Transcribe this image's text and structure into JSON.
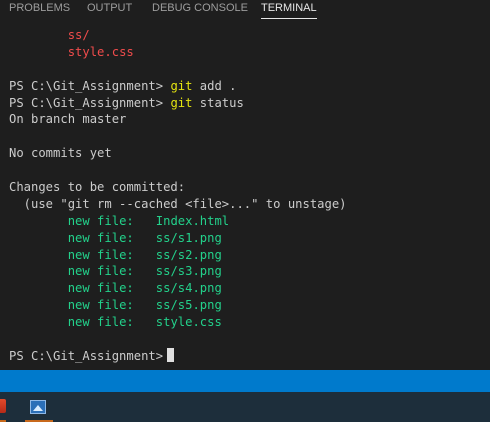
{
  "panel": {
    "tabs": [
      {
        "label": "PROBLEMS"
      },
      {
        "label": "OUTPUT"
      },
      {
        "label": "DEBUG CONSOLE"
      },
      {
        "label": "TERMINAL"
      }
    ],
    "active_tab": "TERMINAL"
  },
  "terminal": {
    "lines": {
      "l0": "ss/",
      "l1": "style.css",
      "prompt1": "PS C:\\Git_Assignment> ",
      "cmd1a": "git",
      "cmd1b": " add .",
      "prompt2": "PS C:\\Git_Assignment> ",
      "cmd2a": "git",
      "cmd2b": " status",
      "branch": "On branch master",
      "no_commits": "No commits yet",
      "changes": "Changes to be committed:",
      "hint": "  (use \"git rm --cached <file>...\" to unstage)",
      "staged": [
        {
          "status": "new file:",
          "file": "Index.html"
        },
        {
          "status": "new file:",
          "file": "ss/s1.png"
        },
        {
          "status": "new file:",
          "file": "ss/s2.png"
        },
        {
          "status": "new file:",
          "file": "ss/s3.png"
        },
        {
          "status": "new file:",
          "file": "ss/s4.png"
        },
        {
          "status": "new file:",
          "file": "ss/s5.png"
        },
        {
          "status": "new file:",
          "file": "style.css"
        }
      ],
      "prompt3": "PS C:\\Git_Assignment>"
    }
  },
  "colors": {
    "background": "#1e1e1e",
    "statusbar": "#007acc",
    "added": "#23d18b",
    "command": "#e5e510",
    "untracked": "#f14c4c"
  },
  "taskbar": {
    "icons": [
      "app-icon",
      "photos-icon"
    ]
  }
}
